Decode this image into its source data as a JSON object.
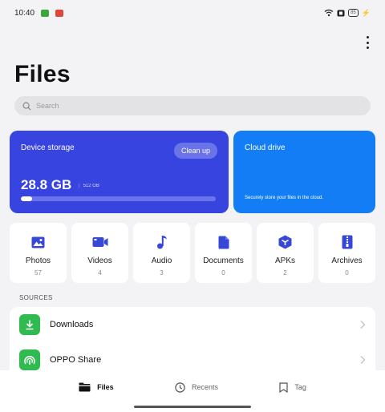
{
  "status": {
    "time": "10:40",
    "battery": "85"
  },
  "header": {
    "title": "Files"
  },
  "search": {
    "placeholder": "Search"
  },
  "storage": {
    "title": "Device storage",
    "clean_up": "Clean up",
    "used": "28.8 GB",
    "total": "512 GB",
    "used_fraction": 0.056
  },
  "cloud": {
    "title": "Cloud drive",
    "description": "Securely store your files in the cloud."
  },
  "categories": [
    {
      "label": "Photos",
      "count": "57",
      "icon": "photo-icon"
    },
    {
      "label": "Videos",
      "count": "4",
      "icon": "video-icon"
    },
    {
      "label": "Audio",
      "count": "3",
      "icon": "music-note-icon"
    },
    {
      "label": "Documents",
      "count": "0",
      "icon": "document-icon"
    },
    {
      "label": "APKs",
      "count": "2",
      "icon": "package-icon"
    },
    {
      "label": "Archives",
      "count": "0",
      "icon": "archive-icon"
    }
  ],
  "sources": {
    "label": "SOURCES",
    "items": [
      {
        "label": "Downloads",
        "icon": "download-icon"
      },
      {
        "label": "OPPO Share",
        "icon": "share-icon"
      }
    ]
  },
  "nav": {
    "files": "Files",
    "recents": "Recents",
    "tag": "Tag"
  },
  "colors": {
    "storage_card": "#3844e0",
    "cloud_card": "#127df5",
    "category_icon": "#3848d6",
    "source_icon": "#2fbb4f"
  }
}
